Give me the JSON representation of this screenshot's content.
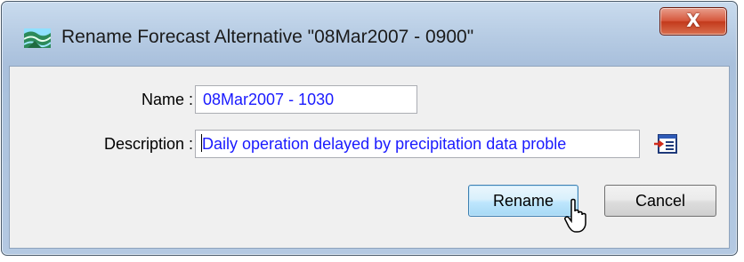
{
  "window": {
    "title": "Rename Forecast Alternative \"08Mar2007 - 0900\"",
    "close_symbol": "X",
    "app_icon": "forecast-app-icon"
  },
  "form": {
    "name_label": "Name :",
    "name_value": "08Mar2007 - 1030",
    "description_label": "Description :",
    "description_value": "Daily operation delayed by precipitation data proble",
    "description_editor_icon": "text-editor-icon"
  },
  "buttons": {
    "rename": "Rename",
    "cancel": "Cancel"
  },
  "colors": {
    "field_text": "#1a1aff",
    "close_button": "#c33a1c",
    "default_button_border": "#3c7fb1"
  }
}
